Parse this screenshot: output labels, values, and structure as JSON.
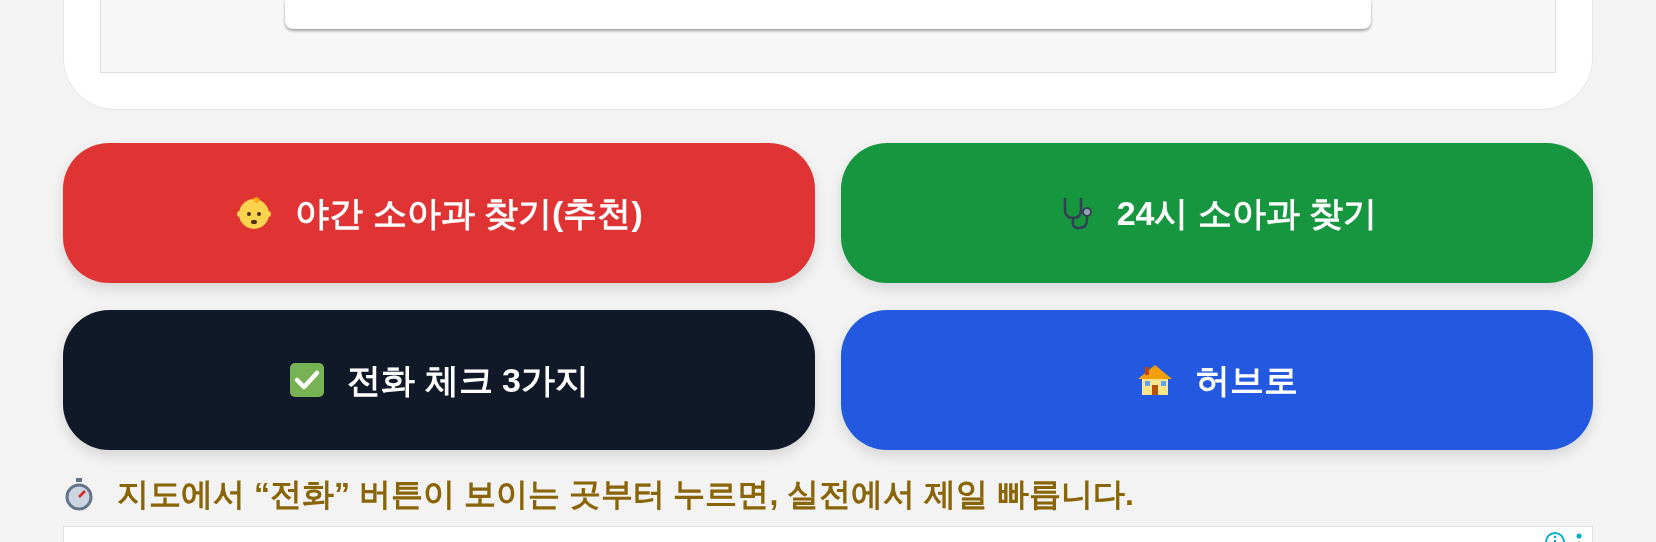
{
  "buttons": [
    {
      "label": "야간 소아과 찾기(추천)",
      "kind": "baby",
      "color": "#e03333"
    },
    {
      "label": "24시 소아과 찾기",
      "kind": "stethoscope",
      "color": "#16963f"
    },
    {
      "label": "전화 체크 3가지",
      "kind": "check",
      "color": "#111827"
    },
    {
      "label": "허브로",
      "kind": "house",
      "color": "#2359e0"
    }
  ],
  "tip": {
    "text": "지도에서 “전화” 버튼이 보이는 곳부터 누르면, 실전에서 제일 빠릅니다."
  }
}
